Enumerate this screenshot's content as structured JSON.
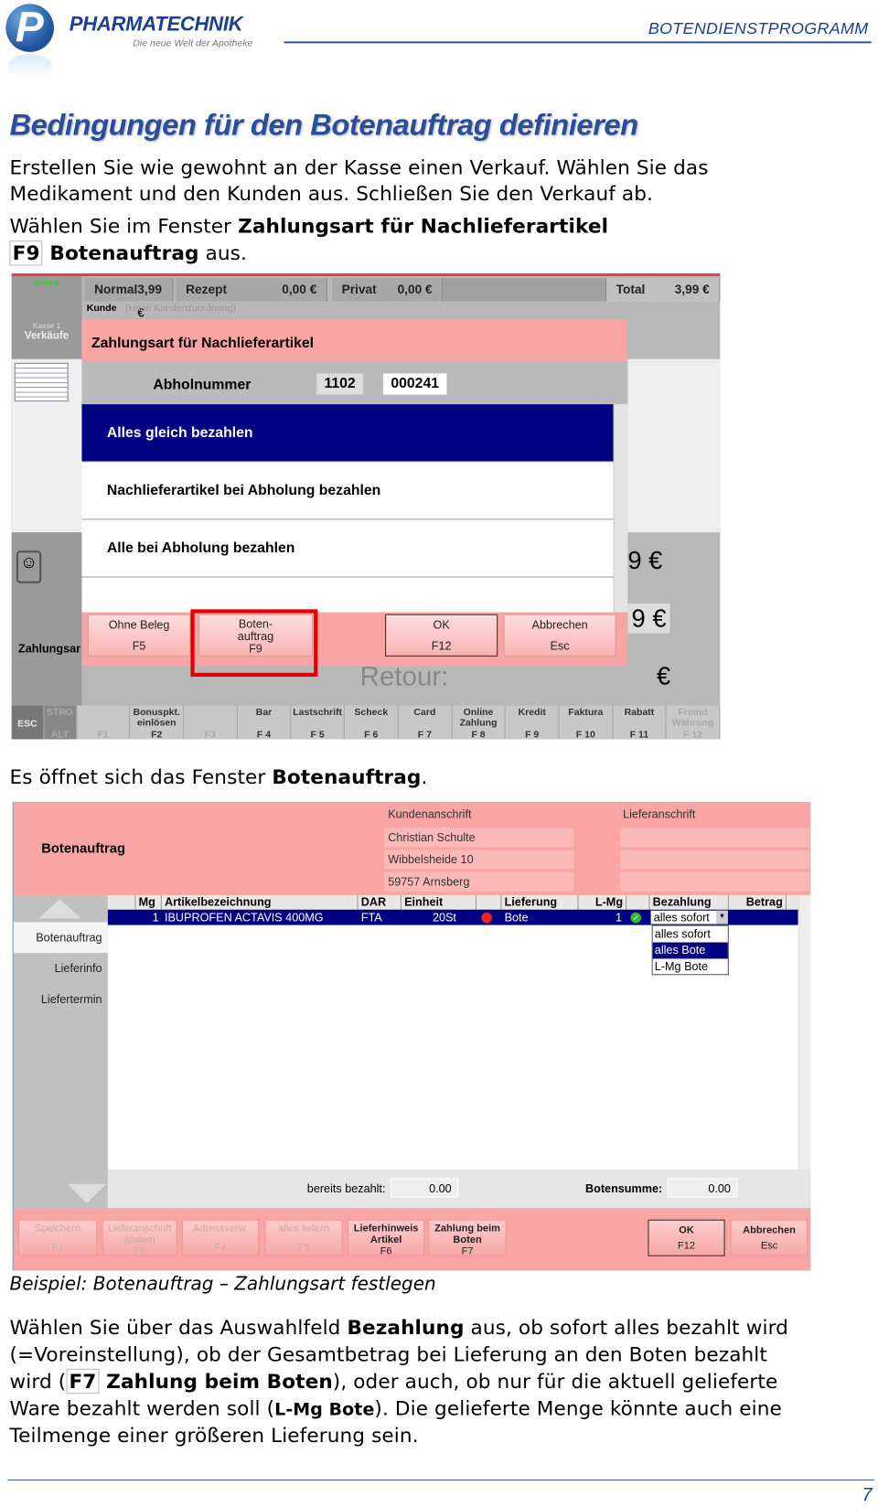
{
  "header": {
    "brand": "PHARMATECHNIK",
    "tagline": "Die neue Welt der Apotheke",
    "section": "BOTENDIENSTPROGRAMM",
    "logo_letter": "P"
  },
  "title": "Bedingungen für den Botenauftrag definieren",
  "intro": {
    "line1": "Erstellen Sie wie gewohnt an der Kasse einen Verkauf. Wählen Sie das",
    "line2": "Medikament und den Kunden aus. Schließen Sie den Verkauf ab.",
    "line3_pre": "Wählen Sie im Fenster ",
    "line3_bold": "Zahlungsart für Nachlieferartikel",
    "line4_key": "F9",
    "line4_bold": " Botenauftrag",
    "line4_post": " aus."
  },
  "screen1": {
    "online": "online",
    "kasse": "Kasse 1",
    "verkaeufe": "Verkäufe",
    "tabs": [
      {
        "label": "Normal",
        "value": "3,99 €"
      },
      {
        "label": "Rezept",
        "value": "0,00 €"
      },
      {
        "label": "Privat",
        "value": "0,00 €"
      }
    ],
    "total_label": "Total",
    "total_value": "3,99 €",
    "kunde_label": "Kunde",
    "kunde_value": "(keine Kundenzuordnung)",
    "zahlungsart": "Zahlungsar",
    "retour": "Retour:",
    "euro1": "9 €",
    "euro2": "9 €",
    "euro3": "€",
    "dialog": {
      "title": "Zahlungsart für Nachlieferartikel",
      "abhol_label": "Abholnummer",
      "abhol_1": "1102",
      "abhol_2": "000241",
      "options": [
        "Alles gleich bezahlen",
        "Nachlieferartikel bei Abholung bezahlen",
        "Alle bei Abholung bezahlen"
      ],
      "buttons": [
        {
          "label": "Ohne Beleg",
          "key": "F5"
        },
        {
          "label": "Boten-\nauftrag",
          "key": "F9"
        },
        {
          "label": "OK",
          "key": "F12"
        },
        {
          "label": "Abbrechen",
          "key": "Esc"
        }
      ]
    },
    "fkeys": [
      {
        "label": "ESC",
        "key": ""
      },
      {
        "label": "STRG",
        "key": "ALT"
      },
      {
        "label": "",
        "key": "F1"
      },
      {
        "label": "Bonuspkt. einlösen",
        "key": "F2"
      },
      {
        "label": "",
        "key": "F3"
      },
      {
        "label": "Bar",
        "key": "F 4"
      },
      {
        "label": "Lastschrift",
        "key": "F 5"
      },
      {
        "label": "Scheck",
        "key": "F 6"
      },
      {
        "label": "Card",
        "key": "F 7"
      },
      {
        "label": "Online Zahlung",
        "key": "F 8"
      },
      {
        "label": "Kredit",
        "key": "F 9"
      },
      {
        "label": "Faktura",
        "key": "F 10"
      },
      {
        "label": "Rabatt",
        "key": "F 11"
      },
      {
        "label": "Fremd Währung",
        "key": "F 12"
      }
    ]
  },
  "text2": {
    "pre": "Es öffnet sich das Fenster ",
    "bold": "Botenauftrag",
    "post": "."
  },
  "screen2": {
    "title": "Botenauftrag",
    "kunden_label": "Kundenanschrift",
    "liefer_label": "Lieferanschrift",
    "kunden": [
      "Christian Schulte",
      "Wibbelsheide 10",
      "59757 Arnsberg"
    ],
    "nav": [
      "Botenauftrag",
      "Lieferinfo",
      "Liefertermin"
    ],
    "columns": [
      "Mg",
      "Artikelbezeichnung",
      "DAR",
      "Einheit",
      "Lieferung",
      "L-Mg",
      "Bezahlung",
      "Betrag"
    ],
    "row": {
      "mg": "1",
      "artikel": "IBUPROFEN ACTAVIS 400MG",
      "dar": "FTA",
      "einheit": "20St",
      "lieferung": "Bote",
      "lmg": "1",
      "bezahlung": "alles sofort"
    },
    "dropdown": [
      "alles sofort",
      "alles Bote",
      "L-Mg Bote"
    ],
    "bereits_label": "bereits bezahlt:",
    "bereits_value": "0.00",
    "summe_label": "Botensumme:",
    "summe_value": "0.00",
    "buttons": [
      {
        "label": "Speichern",
        "key": "F1"
      },
      {
        "label": "Lieferanschrift ändern",
        "key": "F3"
      },
      {
        "label": "Adressverw.",
        "key": "F4"
      },
      {
        "label": "alles liefern",
        "key": "F5"
      },
      {
        "label": "Lieferhinweis Artikel",
        "key": "F6"
      },
      {
        "label": "Zahlung beim Boten",
        "key": "F7"
      },
      {
        "label": "OK",
        "key": "F12"
      },
      {
        "label": "Abbrechen",
        "key": "Esc"
      }
    ]
  },
  "caption": "Beispiel: Botenauftrag – Zahlungsart festlegen",
  "body": {
    "l1_pre": "Wählen Sie über das Auswahlfeld ",
    "l1_bold": "Bezahlung",
    "l1_post": " aus, ob sofort alles bezahlt wird",
    "l2": "(=Voreinstellung), ob der Gesamtbetrag bei Lieferung an den Boten bezahlt",
    "l3_pre": "wird (",
    "l3_key": "F7",
    "l3_bold": " Zahlung beim Boten",
    "l3_post": "), oder auch, ob nur für die aktuell gelieferte",
    "l4_pre": "Ware bezahlt werden soll (",
    "l4_bold": "L-Mg Bote",
    "l4_post": "). Die gelieferte Menge könnte auch eine",
    "l5": "Teilmenge einer größeren Lieferung sein."
  },
  "footer": {
    "page": "7"
  },
  "colors": {
    "brand": "#1d3f8e",
    "dialog_pink": "#f9a5a5",
    "selection_navy": "#000080",
    "highlight_red": "#e00000"
  }
}
